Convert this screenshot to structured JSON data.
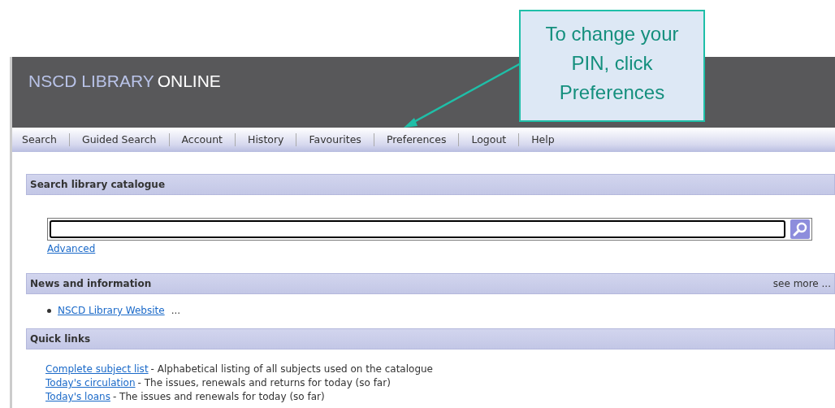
{
  "header": {
    "title_prefix": "NSCD LIBRARY",
    "title_suffix": "ONLINE"
  },
  "nav": [
    {
      "label": "Search"
    },
    {
      "label": "Guided Search"
    },
    {
      "label": "Account"
    },
    {
      "label": "History"
    },
    {
      "label": "Favourites"
    },
    {
      "label": "Preferences"
    },
    {
      "label": "Logout"
    },
    {
      "label": "Help"
    }
  ],
  "callout": {
    "text": "To change your PIN, click Preferences"
  },
  "search_section": {
    "heading": "Search library catalogue",
    "advanced_link": "Advanced"
  },
  "news_section": {
    "heading": "News and information",
    "see_more": "see more ...",
    "items": [
      {
        "link": "NSCD Library Website",
        "suffix": "..."
      }
    ]
  },
  "quick_links": {
    "heading": "Quick links",
    "items": [
      {
        "link": "Complete subject list",
        "description": "- Alphabetical listing of all subjects used on the catalogue"
      },
      {
        "link": "Today's circulation",
        "description": "- The issues, renewals and returns for today (so far)"
      },
      {
        "link": "Today's loans",
        "description": "- The issues and renewals for today (so far)"
      }
    ]
  }
}
